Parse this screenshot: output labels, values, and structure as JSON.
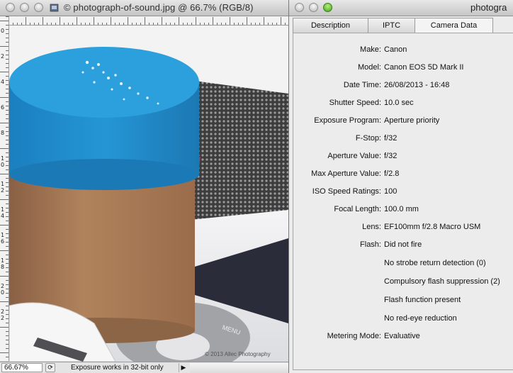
{
  "document_window": {
    "title": "photograph-of-sound.jpg @ 66.7% (RGB/8)",
    "title_prefix": "©",
    "ruler_marks_top": [
      "0",
      "2",
      "4",
      "6",
      "8",
      "10",
      "12",
      "14",
      "16",
      "18",
      "20",
      "22",
      "24",
      "26",
      "28",
      "30"
    ],
    "ruler_marks_left": [
      "0",
      "2",
      "4",
      "6",
      "8",
      "10",
      "12",
      "14",
      "16",
      "18",
      "20",
      "22"
    ],
    "status_bar": {
      "zoom": "66.67%",
      "message": "Exposure works in 32-bit only",
      "arrow": "▶"
    },
    "watermark": "© 2013 Allec Photography",
    "ipod_label": "MENU"
  },
  "info_window": {
    "title": "photogra",
    "tabs": [
      "Description",
      "IPTC",
      "Camera Data"
    ],
    "active_tab": "Camera Data",
    "camera_data": [
      {
        "label": "Make:",
        "value": "Canon"
      },
      {
        "label": "Model:",
        "value": "Canon EOS 5D Mark II"
      },
      {
        "label": "Date Time:",
        "value": "26/08/2013 - 16:48"
      },
      {
        "label": "Shutter Speed:",
        "value": "10.0 sec"
      },
      {
        "label": "Exposure Program:",
        "value": "Aperture priority"
      },
      {
        "label": "F-Stop:",
        "value": "f/32"
      },
      {
        "label": "Aperture Value:",
        "value": "f/32"
      },
      {
        "label": "Max Aperture Value:",
        "value": "f/2.8"
      },
      {
        "label": "ISO Speed Ratings:",
        "value": "100"
      },
      {
        "label": "Focal Length:",
        "value": "100.0 mm"
      },
      {
        "label": "Lens:",
        "value": "EF100mm f/2.8 Macro USM"
      },
      {
        "label": "Flash:",
        "value": "Did not fire"
      },
      {
        "label": "",
        "value": "No strobe return detection (0)"
      },
      {
        "label": "",
        "value": "Compulsory flash suppression (2)"
      },
      {
        "label": "",
        "value": "Flash function present"
      },
      {
        "label": "",
        "value": "No red-eye reduction"
      },
      {
        "label": "Metering Mode:",
        "value": "Evaluative"
      }
    ]
  },
  "colors": {
    "cap_blue": "#1f8fcf",
    "band_red": "#c2304c",
    "tube_brown": "#a97a56",
    "window_chrome": "#ececec"
  }
}
